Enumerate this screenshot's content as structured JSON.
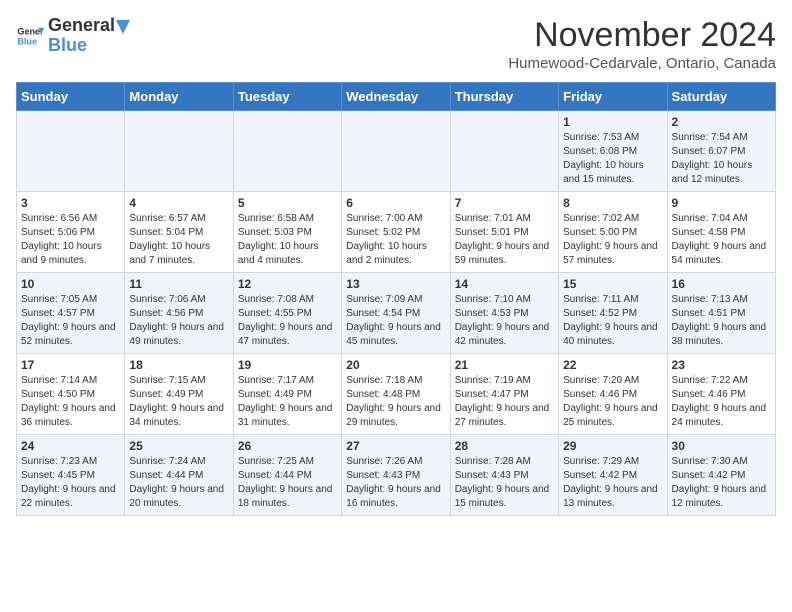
{
  "header": {
    "logo_general": "General",
    "logo_blue": "Blue",
    "month_year": "November 2024",
    "location": "Humewood-Cedarvale, Ontario, Canada"
  },
  "weekdays": [
    "Sunday",
    "Monday",
    "Tuesday",
    "Wednesday",
    "Thursday",
    "Friday",
    "Saturday"
  ],
  "weeks": [
    [
      {
        "day": "",
        "info": ""
      },
      {
        "day": "",
        "info": ""
      },
      {
        "day": "",
        "info": ""
      },
      {
        "day": "",
        "info": ""
      },
      {
        "day": "",
        "info": ""
      },
      {
        "day": "1",
        "info": "Sunrise: 7:53 AM\nSunset: 6:08 PM\nDaylight: 10 hours and 15 minutes."
      },
      {
        "day": "2",
        "info": "Sunrise: 7:54 AM\nSunset: 6:07 PM\nDaylight: 10 hours and 12 minutes."
      }
    ],
    [
      {
        "day": "3",
        "info": "Sunrise: 6:56 AM\nSunset: 5:06 PM\nDaylight: 10 hours and 9 minutes."
      },
      {
        "day": "4",
        "info": "Sunrise: 6:57 AM\nSunset: 5:04 PM\nDaylight: 10 hours and 7 minutes."
      },
      {
        "day": "5",
        "info": "Sunrise: 6:58 AM\nSunset: 5:03 PM\nDaylight: 10 hours and 4 minutes."
      },
      {
        "day": "6",
        "info": "Sunrise: 7:00 AM\nSunset: 5:02 PM\nDaylight: 10 hours and 2 minutes."
      },
      {
        "day": "7",
        "info": "Sunrise: 7:01 AM\nSunset: 5:01 PM\nDaylight: 9 hours and 59 minutes."
      },
      {
        "day": "8",
        "info": "Sunrise: 7:02 AM\nSunset: 5:00 PM\nDaylight: 9 hours and 57 minutes."
      },
      {
        "day": "9",
        "info": "Sunrise: 7:04 AM\nSunset: 4:58 PM\nDaylight: 9 hours and 54 minutes."
      }
    ],
    [
      {
        "day": "10",
        "info": "Sunrise: 7:05 AM\nSunset: 4:57 PM\nDaylight: 9 hours and 52 minutes."
      },
      {
        "day": "11",
        "info": "Sunrise: 7:06 AM\nSunset: 4:56 PM\nDaylight: 9 hours and 49 minutes."
      },
      {
        "day": "12",
        "info": "Sunrise: 7:08 AM\nSunset: 4:55 PM\nDaylight: 9 hours and 47 minutes."
      },
      {
        "day": "13",
        "info": "Sunrise: 7:09 AM\nSunset: 4:54 PM\nDaylight: 9 hours and 45 minutes."
      },
      {
        "day": "14",
        "info": "Sunrise: 7:10 AM\nSunset: 4:53 PM\nDaylight: 9 hours and 42 minutes."
      },
      {
        "day": "15",
        "info": "Sunrise: 7:11 AM\nSunset: 4:52 PM\nDaylight: 9 hours and 40 minutes."
      },
      {
        "day": "16",
        "info": "Sunrise: 7:13 AM\nSunset: 4:51 PM\nDaylight: 9 hours and 38 minutes."
      }
    ],
    [
      {
        "day": "17",
        "info": "Sunrise: 7:14 AM\nSunset: 4:50 PM\nDaylight: 9 hours and 36 minutes."
      },
      {
        "day": "18",
        "info": "Sunrise: 7:15 AM\nSunset: 4:49 PM\nDaylight: 9 hours and 34 minutes."
      },
      {
        "day": "19",
        "info": "Sunrise: 7:17 AM\nSunset: 4:49 PM\nDaylight: 9 hours and 31 minutes."
      },
      {
        "day": "20",
        "info": "Sunrise: 7:18 AM\nSunset: 4:48 PM\nDaylight: 9 hours and 29 minutes."
      },
      {
        "day": "21",
        "info": "Sunrise: 7:19 AM\nSunset: 4:47 PM\nDaylight: 9 hours and 27 minutes."
      },
      {
        "day": "22",
        "info": "Sunrise: 7:20 AM\nSunset: 4:46 PM\nDaylight: 9 hours and 25 minutes."
      },
      {
        "day": "23",
        "info": "Sunrise: 7:22 AM\nSunset: 4:46 PM\nDaylight: 9 hours and 24 minutes."
      }
    ],
    [
      {
        "day": "24",
        "info": "Sunrise: 7:23 AM\nSunset: 4:45 PM\nDaylight: 9 hours and 22 minutes."
      },
      {
        "day": "25",
        "info": "Sunrise: 7:24 AM\nSunset: 4:44 PM\nDaylight: 9 hours and 20 minutes."
      },
      {
        "day": "26",
        "info": "Sunrise: 7:25 AM\nSunset: 4:44 PM\nDaylight: 9 hours and 18 minutes."
      },
      {
        "day": "27",
        "info": "Sunrise: 7:26 AM\nSunset: 4:43 PM\nDaylight: 9 hours and 16 minutes."
      },
      {
        "day": "28",
        "info": "Sunrise: 7:28 AM\nSunset: 4:43 PM\nDaylight: 9 hours and 15 minutes."
      },
      {
        "day": "29",
        "info": "Sunrise: 7:29 AM\nSunset: 4:42 PM\nDaylight: 9 hours and 13 minutes."
      },
      {
        "day": "30",
        "info": "Sunrise: 7:30 AM\nSunset: 4:42 PM\nDaylight: 9 hours and 12 minutes."
      }
    ]
  ]
}
